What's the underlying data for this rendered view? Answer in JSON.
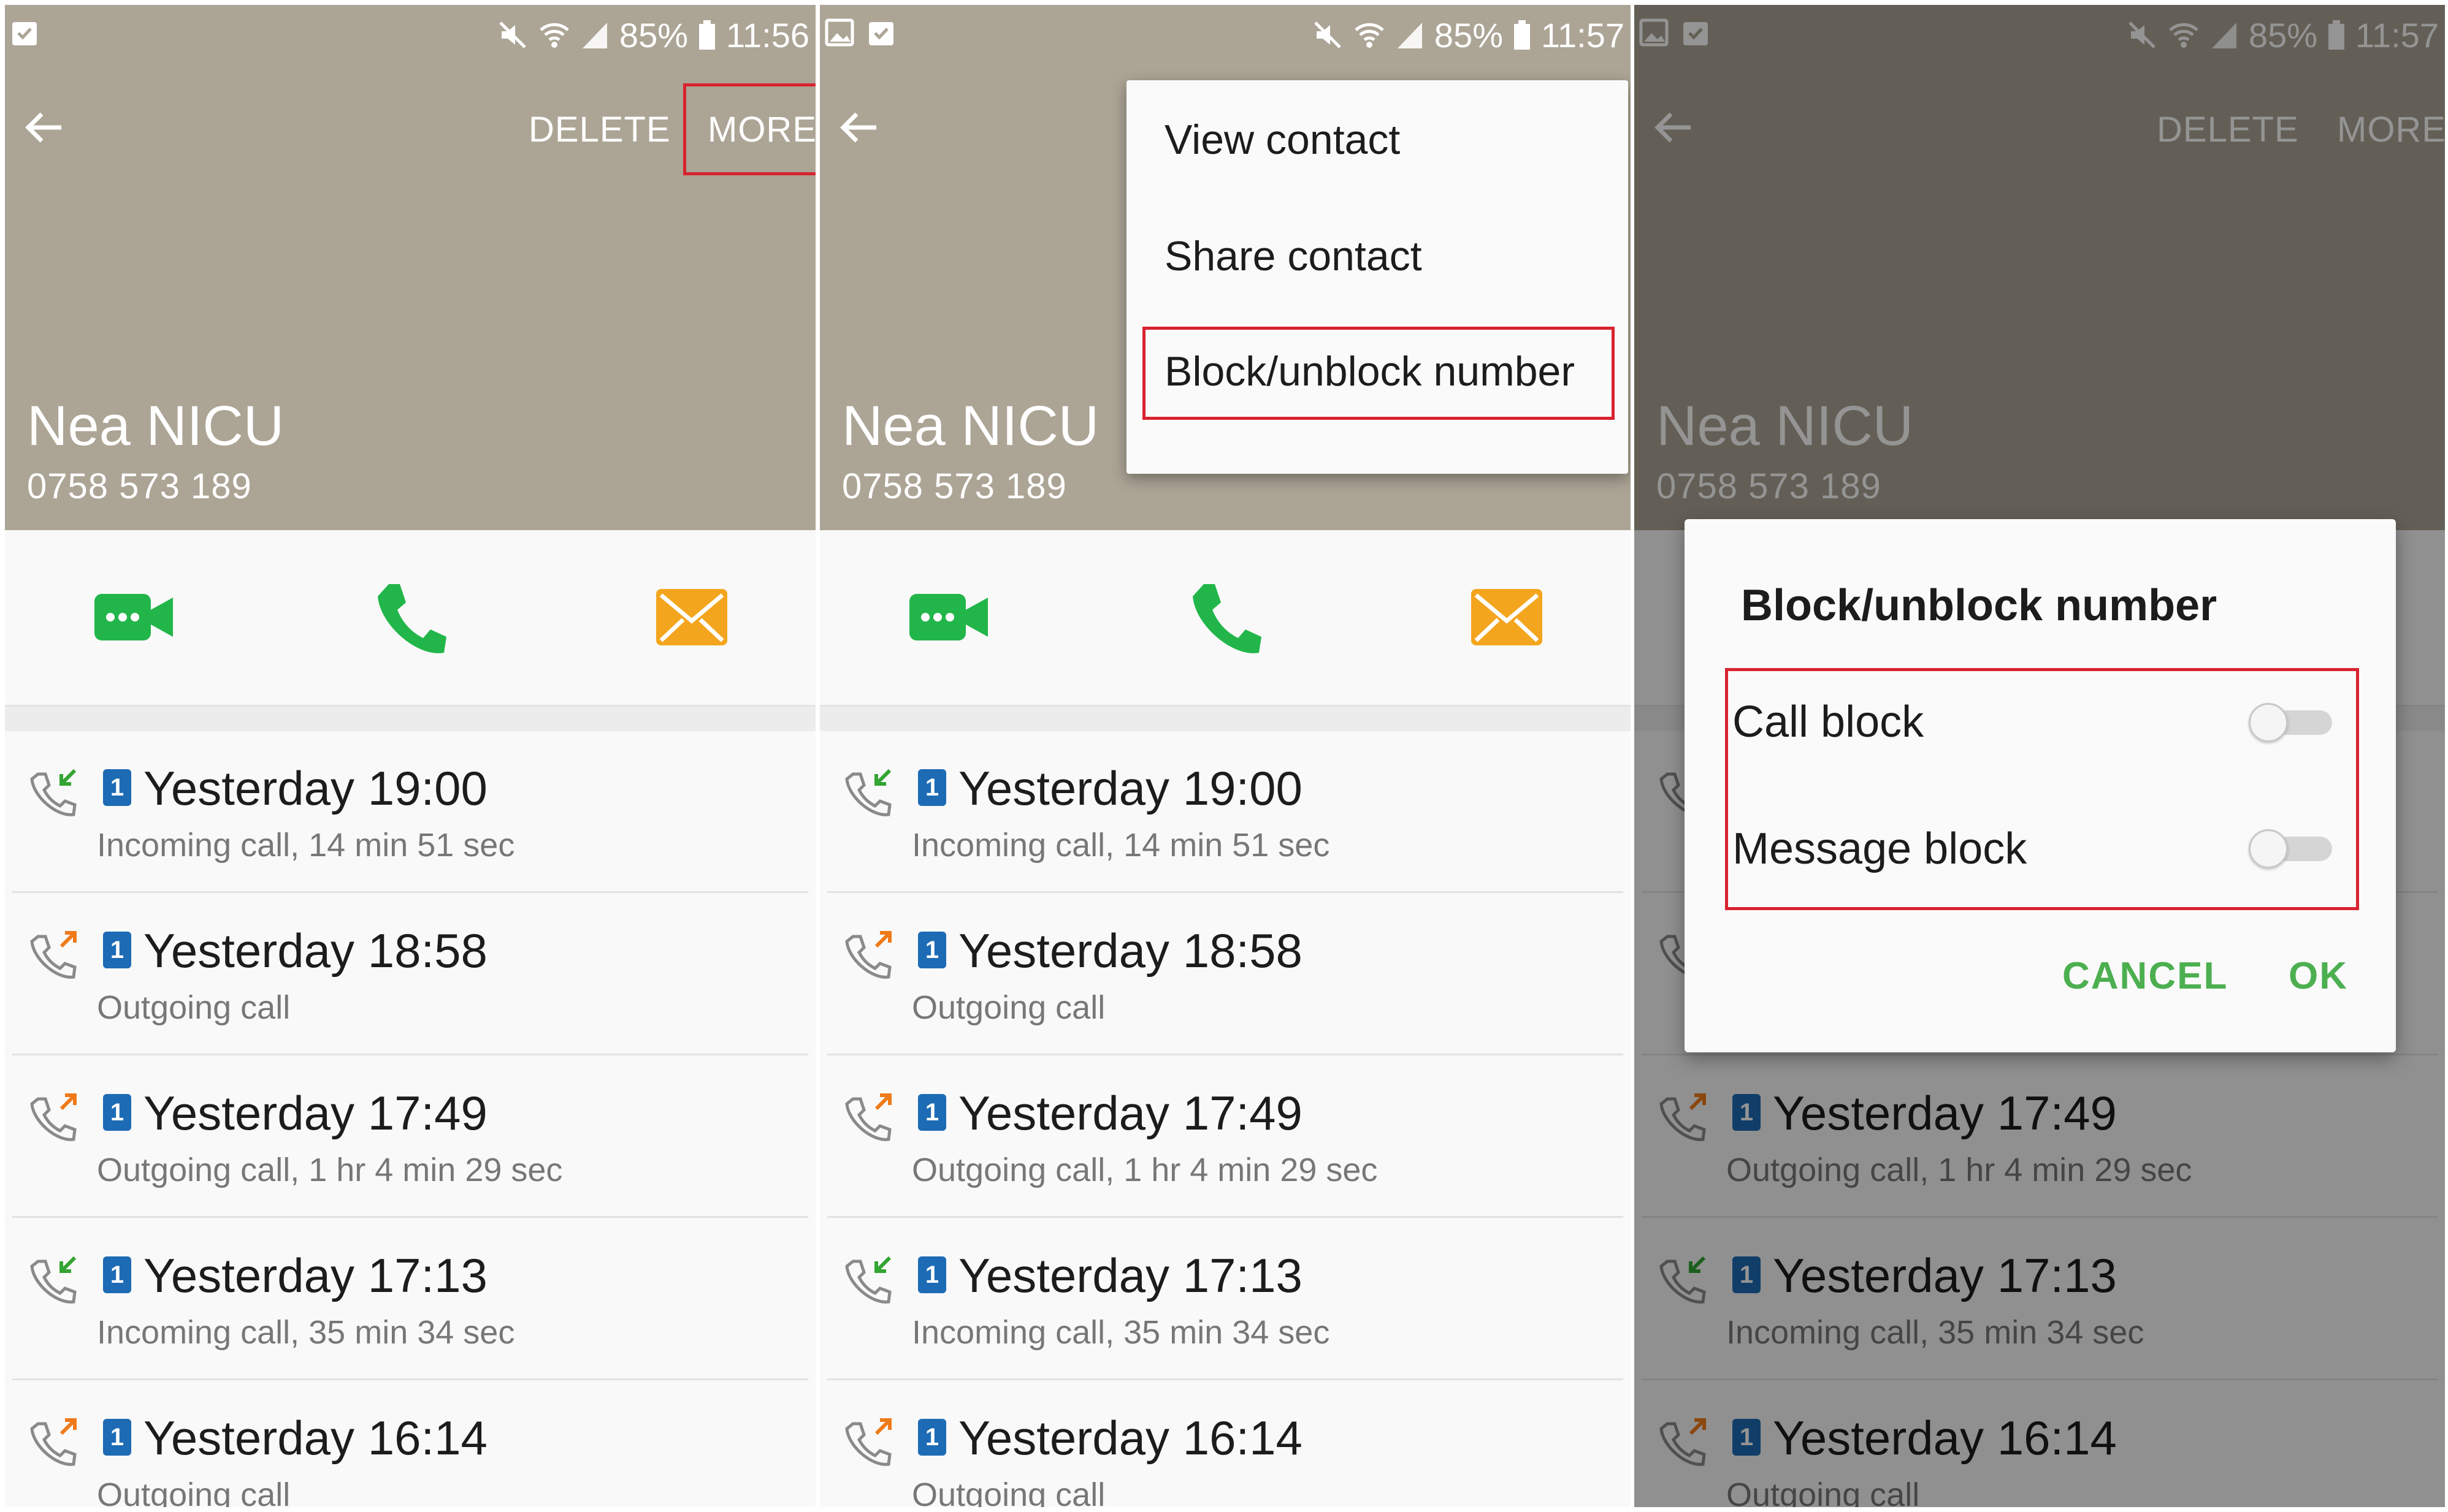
{
  "colors": {
    "header_bg": "#aca495",
    "highlight": "#d9232f",
    "accent_green": "#4caf50",
    "video_green": "#22b64a",
    "message_orange": "#f4a51e",
    "sim_blue": "#1d6bb5",
    "incoming_arrow": "#33a532",
    "outgoing_arrow": "#ef7a1a"
  },
  "status": {
    "battery": "85%",
    "times": [
      "11:56",
      "11:57",
      "11:57"
    ]
  },
  "toolbar": {
    "delete_label": "DELETE",
    "more_label": "MORE"
  },
  "contact": {
    "name": "Nea NICU",
    "number": "0758 573 189"
  },
  "actions": {
    "video_icon": "video-call-icon",
    "call_icon": "phone-icon",
    "message_icon": "envelope-icon"
  },
  "calls": [
    {
      "time": "Yesterday 19:00",
      "detail": "Incoming call, 14 min 51 sec",
      "direction": "incoming",
      "sim": "1"
    },
    {
      "time": "Yesterday 18:58",
      "detail": "Outgoing call",
      "direction": "outgoing",
      "sim": "1"
    },
    {
      "time": "Yesterday 17:49",
      "detail": "Outgoing call, 1 hr 4 min 29 sec",
      "direction": "outgoing",
      "sim": "1"
    },
    {
      "time": "Yesterday 17:13",
      "detail": "Incoming call, 35 min 34 sec",
      "direction": "incoming",
      "sim": "1"
    },
    {
      "time": "Yesterday 16:14",
      "detail": "Outgoing call",
      "direction": "outgoing",
      "sim": "1"
    }
  ],
  "menu": {
    "items": [
      "View contact",
      "Share contact",
      "Block/unblock number"
    ]
  },
  "dialog": {
    "title": "Block/unblock number",
    "call_block": "Call block",
    "message_block": "Message block",
    "call_block_on": false,
    "message_block_on": false,
    "cancel": "CANCEL",
    "ok": "OK"
  }
}
